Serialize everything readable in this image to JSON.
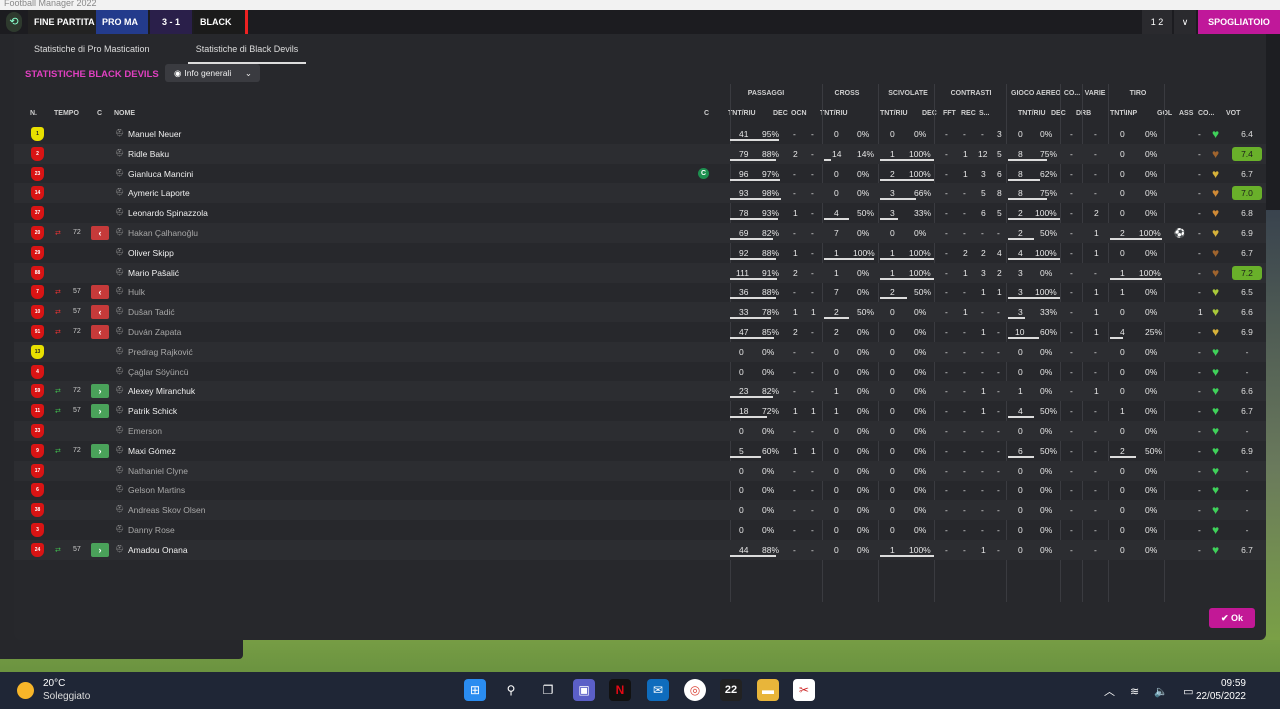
{
  "window": {
    "title": "Football Manager 2022"
  },
  "topbar": {
    "status": "FINE PARTITA",
    "home": "PRO MA",
    "score": "3 - 1",
    "away": "BLACK",
    "right_a": "1 2",
    "right_b": "∨",
    "right_c": "SPOGLIATOIO"
  },
  "tabs": [
    "Statistiche di Pro Mastication",
    "Statistiche di Black Devils"
  ],
  "section_title": "STATISTICHE BLACK DEVILS",
  "view_select": "Info generali",
  "groups": [
    "PASSAGGI",
    "CROSS",
    "SCIVOLATE",
    "CONTRASTI",
    "GIOCO AEREO",
    "CO...",
    "VARIE",
    "TIRO"
  ],
  "columns": [
    "N.",
    "TEMPO",
    "C",
    "NOME",
    "C",
    "TNT/RIU",
    "DEC",
    "OCN",
    "TNT/RIU",
    "TNT/RIU",
    "DEC",
    "FFT",
    "REC",
    "S...",
    "TNT/RIU",
    "DEC",
    "DRB",
    "TNT\\INP",
    "GOL",
    "ASS",
    "CO...",
    "VOT"
  ],
  "players": [
    {
      "name": "Manuel Neuer",
      "num": "1",
      "gk": true,
      "sub": "",
      "min": "",
      "dim": false,
      "cap": false,
      "pass": "41",
      "passp": "95%",
      "pdec": "-",
      "pocn": "-",
      "cross": "0",
      "crossp": "0%",
      "sciv": "0",
      "scivp": "0%",
      "cdec": "-",
      "cfft": "-",
      "crec": "-",
      "cs": "3",
      "aer": "0",
      "aerp": "0%",
      "codec": "-",
      "drb": "-",
      "tiro": "0",
      "tirop": "0%",
      "gol": "",
      "ass": "-",
      "heart": "#3fd15a",
      "vote": "6.4",
      "hi": false,
      "ball": false,
      "pb": 0.95,
      "cb": 0,
      "sb": 0,
      "ab": 0,
      "tb": 0
    },
    {
      "name": "Ridle Baku",
      "num": "2",
      "gk": false,
      "sub": "",
      "min": "",
      "dim": false,
      "cap": false,
      "pass": "79",
      "passp": "88%",
      "pdec": "2",
      "pocn": "-",
      "cross": "14",
      "crossp": "14%",
      "sciv": "1",
      "scivp": "100%",
      "cdec": "-",
      "cfft": "1",
      "crec": "12",
      "cs": "5",
      "aer": "8",
      "aerp": "75%",
      "codec": "-",
      "drb": "-",
      "tiro": "0",
      "tirop": "0%",
      "gol": "",
      "ass": "-",
      "heart": "#a0642e",
      "vote": "7.4",
      "hi": true,
      "ball": false,
      "pb": 0.88,
      "cb": 0.14,
      "sb": 1,
      "ab": 0.75,
      "tb": 0
    },
    {
      "name": "Gianluca Mancini",
      "num": "23",
      "gk": false,
      "sub": "",
      "min": "",
      "dim": false,
      "cap": true,
      "pass": "96",
      "passp": "97%",
      "pdec": "-",
      "pocn": "-",
      "cross": "0",
      "crossp": "0%",
      "sciv": "2",
      "scivp": "100%",
      "cdec": "-",
      "cfft": "1",
      "crec": "3",
      "cs": "6",
      "aer": "8",
      "aerp": "62%",
      "codec": "-",
      "drb": "-",
      "tiro": "0",
      "tirop": "0%",
      "gol": "",
      "ass": "-",
      "heart": "#d6b23a",
      "vote": "6.7",
      "hi": false,
      "ball": false,
      "pb": 0.97,
      "cb": 0,
      "sb": 1,
      "ab": 0.62,
      "tb": 0
    },
    {
      "name": "Aymeric Laporte",
      "num": "14",
      "gk": false,
      "sub": "",
      "min": "",
      "dim": false,
      "cap": false,
      "pass": "93",
      "passp": "98%",
      "pdec": "-",
      "pocn": "-",
      "cross": "0",
      "crossp": "0%",
      "sciv": "3",
      "scivp": "66%",
      "cdec": "-",
      "cfft": "-",
      "crec": "5",
      "cs": "8",
      "aer": "8",
      "aerp": "75%",
      "codec": "-",
      "drb": "-",
      "tiro": "0",
      "tirop": "0%",
      "gol": "",
      "ass": "-",
      "heart": "#d08a36",
      "vote": "7.0",
      "hi": true,
      "ball": false,
      "pb": 0.98,
      "cb": 0,
      "sb": 0.66,
      "ab": 0.75,
      "tb": 0
    },
    {
      "name": "Leonardo Spinazzola",
      "num": "37",
      "gk": false,
      "sub": "",
      "min": "",
      "dim": false,
      "cap": false,
      "pass": "78",
      "passp": "93%",
      "pdec": "1",
      "pocn": "-",
      "cross": "4",
      "crossp": "50%",
      "sciv": "3",
      "scivp": "33%",
      "cdec": "-",
      "cfft": "-",
      "crec": "6",
      "cs": "5",
      "aer": "2",
      "aerp": "100%",
      "codec": "-",
      "drb": "2",
      "tiro": "0",
      "tirop": "0%",
      "gol": "",
      "ass": "-",
      "heart": "#d08a36",
      "vote": "6.8",
      "hi": false,
      "ball": false,
      "pb": 0.93,
      "cb": 0.5,
      "sb": 0.33,
      "ab": 1,
      "tb": 0
    },
    {
      "name": "Hakan Çalhanoğlu",
      "num": "20",
      "gk": false,
      "sub": "out",
      "min": "72",
      "dim": true,
      "cap": false,
      "pass": "69",
      "passp": "82%",
      "pdec": "-",
      "pocn": "-",
      "cross": "7",
      "crossp": "0%",
      "sciv": "0",
      "scivp": "0%",
      "cdec": "-",
      "cfft": "-",
      "crec": "-",
      "cs": "-",
      "aer": "2",
      "aerp": "50%",
      "codec": "-",
      "drb": "1",
      "tiro": "2",
      "tirop": "100%",
      "gol": "",
      "ass": "-",
      "heart": "#d6b23a",
      "vote": "6.9",
      "hi": false,
      "ball": true,
      "pb": 0.82,
      "cb": 0,
      "sb": 0,
      "ab": 0.5,
      "tb": 1
    },
    {
      "name": "Oliver Skipp",
      "num": "29",
      "gk": false,
      "sub": "",
      "min": "",
      "dim": false,
      "cap": false,
      "pass": "92",
      "passp": "88%",
      "pdec": "1",
      "pocn": "-",
      "cross": "1",
      "crossp": "100%",
      "sciv": "1",
      "scivp": "100%",
      "cdec": "-",
      "cfft": "2",
      "crec": "2",
      "cs": "4",
      "aer": "4",
      "aerp": "100%",
      "codec": "-",
      "drb": "1",
      "tiro": "0",
      "tirop": "0%",
      "gol": "",
      "ass": "-",
      "heart": "#a0642e",
      "vote": "6.7",
      "hi": false,
      "ball": false,
      "pb": 0.88,
      "cb": 1,
      "sb": 1,
      "ab": 1,
      "tb": 0
    },
    {
      "name": "Mario Pašalić",
      "num": "88",
      "gk": false,
      "sub": "",
      "min": "",
      "dim": false,
      "cap": false,
      "pass": "111",
      "passp": "91%",
      "pdec": "2",
      "pocn": "-",
      "cross": "1",
      "crossp": "0%",
      "sciv": "1",
      "scivp": "100%",
      "cdec": "-",
      "cfft": "1",
      "crec": "3",
      "cs": "2",
      "aer": "3",
      "aerp": "0%",
      "codec": "-",
      "drb": "-",
      "tiro": "1",
      "tirop": "100%",
      "gol": "",
      "ass": "-",
      "heart": "#a0642e",
      "vote": "7.2",
      "hi": true,
      "ball": false,
      "pb": 0.91,
      "cb": 0,
      "sb": 1,
      "ab": 0,
      "tb": 1
    },
    {
      "name": "Hulk",
      "num": "7",
      "gk": false,
      "sub": "out",
      "min": "57",
      "dim": true,
      "cap": false,
      "pass": "36",
      "passp": "88%",
      "pdec": "-",
      "pocn": "-",
      "cross": "7",
      "crossp": "0%",
      "sciv": "2",
      "scivp": "50%",
      "cdec": "-",
      "cfft": "-",
      "crec": "1",
      "cs": "1",
      "aer": "3",
      "aerp": "100%",
      "codec": "-",
      "drb": "1",
      "tiro": "1",
      "tirop": "0%",
      "gol": "",
      "ass": "-",
      "heart": "#a9c93a",
      "vote": "6.5",
      "hi": false,
      "ball": false,
      "pb": 0.88,
      "cb": 0,
      "sb": 0.5,
      "ab": 1,
      "tb": 0
    },
    {
      "name": "Dušan Tadić",
      "num": "10",
      "gk": false,
      "sub": "out",
      "min": "57",
      "dim": true,
      "cap": false,
      "pass": "33",
      "passp": "78%",
      "pdec": "1",
      "pocn": "1",
      "cross": "2",
      "crossp": "50%",
      "sciv": "0",
      "scivp": "0%",
      "cdec": "-",
      "cfft": "1",
      "crec": "-",
      "cs": "-",
      "aer": "3",
      "aerp": "33%",
      "codec": "-",
      "drb": "1",
      "tiro": "0",
      "tirop": "0%",
      "gol": "",
      "ass": "1",
      "heart": "#a9c93a",
      "vote": "6.6",
      "hi": false,
      "ball": false,
      "pb": 0.78,
      "cb": 0.5,
      "sb": 0,
      "ab": 0.33,
      "tb": 0
    },
    {
      "name": "Duván Zapata",
      "num": "91",
      "gk": false,
      "sub": "out",
      "min": "72",
      "dim": true,
      "cap": false,
      "pass": "47",
      "passp": "85%",
      "pdec": "2",
      "pocn": "-",
      "cross": "2",
      "crossp": "0%",
      "sciv": "0",
      "scivp": "0%",
      "cdec": "-",
      "cfft": "-",
      "crec": "1",
      "cs": "-",
      "aer": "10",
      "aerp": "60%",
      "codec": "-",
      "drb": "1",
      "tiro": "4",
      "tirop": "25%",
      "gol": "",
      "ass": "-",
      "heart": "#d6b23a",
      "vote": "6.9",
      "hi": false,
      "ball": false,
      "pb": 0.85,
      "cb": 0,
      "sb": 0,
      "ab": 0.6,
      "tb": 0.25
    },
    {
      "name": "Predrag Rajković",
      "num": "13",
      "gk": true,
      "sub": "",
      "min": "",
      "dim": true,
      "cap": false,
      "pass": "0",
      "passp": "0%",
      "pdec": "-",
      "pocn": "-",
      "cross": "0",
      "crossp": "0%",
      "sciv": "0",
      "scivp": "0%",
      "cdec": "-",
      "cfft": "-",
      "crec": "-",
      "cs": "-",
      "aer": "0",
      "aerp": "0%",
      "codec": "-",
      "drb": "-",
      "tiro": "0",
      "tirop": "0%",
      "gol": "",
      "ass": "-",
      "heart": "#3fd15a",
      "vote": "-",
      "hi": false,
      "ball": false,
      "pb": 0,
      "cb": 0,
      "sb": 0,
      "ab": 0,
      "tb": 0
    },
    {
      "name": "Çağlar Söyüncü",
      "num": "4",
      "gk": false,
      "sub": "",
      "min": "",
      "dim": true,
      "cap": false,
      "pass": "0",
      "passp": "0%",
      "pdec": "-",
      "pocn": "-",
      "cross": "0",
      "crossp": "0%",
      "sciv": "0",
      "scivp": "0%",
      "cdec": "-",
      "cfft": "-",
      "crec": "-",
      "cs": "-",
      "aer": "0",
      "aerp": "0%",
      "codec": "-",
      "drb": "-",
      "tiro": "0",
      "tirop": "0%",
      "gol": "",
      "ass": "-",
      "heart": "#3fd15a",
      "vote": "-",
      "hi": false,
      "ball": false,
      "pb": 0,
      "cb": 0,
      "sb": 0,
      "ab": 0,
      "tb": 0
    },
    {
      "name": "Alexey Miranchuk",
      "num": "59",
      "gk": false,
      "sub": "in",
      "min": "72",
      "dim": false,
      "cap": false,
      "pass": "23",
      "passp": "82%",
      "pdec": "-",
      "pocn": "-",
      "cross": "1",
      "crossp": "0%",
      "sciv": "0",
      "scivp": "0%",
      "cdec": "-",
      "cfft": "-",
      "crec": "1",
      "cs": "-",
      "aer": "1",
      "aerp": "0%",
      "codec": "-",
      "drb": "1",
      "tiro": "0",
      "tirop": "0%",
      "gol": "",
      "ass": "-",
      "heart": "#3fd15a",
      "vote": "6.6",
      "hi": false,
      "ball": false,
      "pb": 0.82,
      "cb": 0,
      "sb": 0,
      "ab": 0,
      "tb": 0
    },
    {
      "name": "Patrik Schick",
      "num": "11",
      "gk": false,
      "sub": "in",
      "min": "57",
      "dim": false,
      "cap": false,
      "pass": "18",
      "passp": "72%",
      "pdec": "1",
      "pocn": "1",
      "cross": "1",
      "crossp": "0%",
      "sciv": "0",
      "scivp": "0%",
      "cdec": "-",
      "cfft": "-",
      "crec": "1",
      "cs": "-",
      "aer": "4",
      "aerp": "50%",
      "codec": "-",
      "drb": "-",
      "tiro": "1",
      "tirop": "0%",
      "gol": "",
      "ass": "-",
      "heart": "#3fd15a",
      "vote": "6.7",
      "hi": false,
      "ball": false,
      "pb": 0.72,
      "cb": 0,
      "sb": 0,
      "ab": 0.5,
      "tb": 0
    },
    {
      "name": "Emerson",
      "num": "33",
      "gk": false,
      "sub": "",
      "min": "",
      "dim": true,
      "cap": false,
      "pass": "0",
      "passp": "0%",
      "pdec": "-",
      "pocn": "-",
      "cross": "0",
      "crossp": "0%",
      "sciv": "0",
      "scivp": "0%",
      "cdec": "-",
      "cfft": "-",
      "crec": "-",
      "cs": "-",
      "aer": "0",
      "aerp": "0%",
      "codec": "-",
      "drb": "-",
      "tiro": "0",
      "tirop": "0%",
      "gol": "",
      "ass": "-",
      "heart": "#3fd15a",
      "vote": "-",
      "hi": false,
      "ball": false,
      "pb": 0,
      "cb": 0,
      "sb": 0,
      "ab": 0,
      "tb": 0
    },
    {
      "name": "Maxi Gómez",
      "num": "9",
      "gk": false,
      "sub": "in",
      "min": "72",
      "dim": false,
      "cap": false,
      "pass": "5",
      "passp": "60%",
      "pdec": "1",
      "pocn": "1",
      "cross": "0",
      "crossp": "0%",
      "sciv": "0",
      "scivp": "0%",
      "cdec": "-",
      "cfft": "-",
      "crec": "-",
      "cs": "-",
      "aer": "6",
      "aerp": "50%",
      "codec": "-",
      "drb": "-",
      "tiro": "2",
      "tirop": "50%",
      "gol": "",
      "ass": "-",
      "heart": "#3fd15a",
      "vote": "6.9",
      "hi": false,
      "ball": false,
      "pb": 0.6,
      "cb": 0,
      "sb": 0,
      "ab": 0.5,
      "tb": 0.5
    },
    {
      "name": "Nathaniel Clyne",
      "num": "17",
      "gk": false,
      "sub": "",
      "min": "",
      "dim": true,
      "cap": false,
      "pass": "0",
      "passp": "0%",
      "pdec": "-",
      "pocn": "-",
      "cross": "0",
      "crossp": "0%",
      "sciv": "0",
      "scivp": "0%",
      "cdec": "-",
      "cfft": "-",
      "crec": "-",
      "cs": "-",
      "aer": "0",
      "aerp": "0%",
      "codec": "-",
      "drb": "-",
      "tiro": "0",
      "tirop": "0%",
      "gol": "",
      "ass": "-",
      "heart": "#3fd15a",
      "vote": "-",
      "hi": false,
      "ball": false,
      "pb": 0,
      "cb": 0,
      "sb": 0,
      "ab": 0,
      "tb": 0
    },
    {
      "name": "Gelson Martins",
      "num": "6",
      "gk": false,
      "sub": "",
      "min": "",
      "dim": true,
      "cap": false,
      "pass": "0",
      "passp": "0%",
      "pdec": "-",
      "pocn": "-",
      "cross": "0",
      "crossp": "0%",
      "sciv": "0",
      "scivp": "0%",
      "cdec": "-",
      "cfft": "-",
      "crec": "-",
      "cs": "-",
      "aer": "0",
      "aerp": "0%",
      "codec": "-",
      "drb": "-",
      "tiro": "0",
      "tirop": "0%",
      "gol": "",
      "ass": "-",
      "heart": "#3fd15a",
      "vote": "-",
      "hi": false,
      "ball": false,
      "pb": 0,
      "cb": 0,
      "sb": 0,
      "ab": 0,
      "tb": 0
    },
    {
      "name": "Andreas Skov Olsen",
      "num": "38",
      "gk": false,
      "sub": "",
      "min": "",
      "dim": true,
      "cap": false,
      "pass": "0",
      "passp": "0%",
      "pdec": "-",
      "pocn": "-",
      "cross": "0",
      "crossp": "0%",
      "sciv": "0",
      "scivp": "0%",
      "cdec": "-",
      "cfft": "-",
      "crec": "-",
      "cs": "-",
      "aer": "0",
      "aerp": "0%",
      "codec": "-",
      "drb": "-",
      "tiro": "0",
      "tirop": "0%",
      "gol": "",
      "ass": "-",
      "heart": "#3fd15a",
      "vote": "-",
      "hi": false,
      "ball": false,
      "pb": 0,
      "cb": 0,
      "sb": 0,
      "ab": 0,
      "tb": 0
    },
    {
      "name": "Danny Rose",
      "num": "3",
      "gk": false,
      "sub": "",
      "min": "",
      "dim": true,
      "cap": false,
      "pass": "0",
      "passp": "0%",
      "pdec": "-",
      "pocn": "-",
      "cross": "0",
      "crossp": "0%",
      "sciv": "0",
      "scivp": "0%",
      "cdec": "-",
      "cfft": "-",
      "crec": "-",
      "cs": "-",
      "aer": "0",
      "aerp": "0%",
      "codec": "-",
      "drb": "-",
      "tiro": "0",
      "tirop": "0%",
      "gol": "",
      "ass": "-",
      "heart": "#3fd15a",
      "vote": "-",
      "hi": false,
      "ball": false,
      "pb": 0,
      "cb": 0,
      "sb": 0,
      "ab": 0,
      "tb": 0
    },
    {
      "name": "Amadou Onana",
      "num": "24",
      "gk": false,
      "sub": "in",
      "min": "57",
      "dim": false,
      "cap": false,
      "pass": "44",
      "passp": "88%",
      "pdec": "-",
      "pocn": "-",
      "cross": "0",
      "crossp": "0%",
      "sciv": "1",
      "scivp": "100%",
      "cdec": "-",
      "cfft": "-",
      "crec": "1",
      "cs": "-",
      "aer": "0",
      "aerp": "0%",
      "codec": "-",
      "drb": "-",
      "tiro": "0",
      "tirop": "0%",
      "gol": "",
      "ass": "-",
      "heart": "#3fd15a",
      "vote": "6.7",
      "hi": false,
      "ball": false,
      "pb": 0.88,
      "cb": 0,
      "sb": 1,
      "ab": 0,
      "tb": 0
    }
  ],
  "ok_label": "✔ Ok",
  "taskbar": {
    "temp": "20°C",
    "condition": "Soleggiato",
    "time": "09:59",
    "date": "22/05/2022",
    "apps": [
      "windows-start",
      "search",
      "task-view",
      "teams",
      "netflix",
      "mail",
      "chrome",
      "football-manager-22",
      "file-explorer",
      "snipping-tool"
    ]
  }
}
